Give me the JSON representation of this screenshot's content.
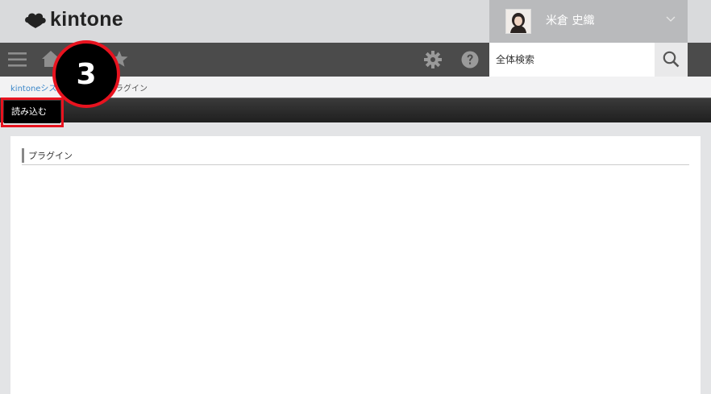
{
  "header": {
    "logo_text": "kintone",
    "user": {
      "name": "米倉 史織"
    }
  },
  "toolbar": {
    "menu_icon": "hamburger-icon",
    "home_icon": "home-icon",
    "favorites_icon": "star-icon",
    "settings_icon": "gear-icon",
    "help_icon": "help-icon",
    "search": {
      "placeholder": "全体検索",
      "button_icon": "search-icon"
    }
  },
  "breadcrumb": {
    "link": "kintoneシス",
    "separator": "",
    "current": "ラグイン"
  },
  "actions": {
    "import_label": "読み込む"
  },
  "main": {
    "section_title": "プラグイン"
  },
  "overlay": {
    "step_number": "3"
  },
  "colors": {
    "header_bg": "#d9dadc",
    "toolbar_bg": "#4b4b4b",
    "user_bg": "#b9babc",
    "link": "#3b87c9",
    "highlight": "#e8131f"
  }
}
